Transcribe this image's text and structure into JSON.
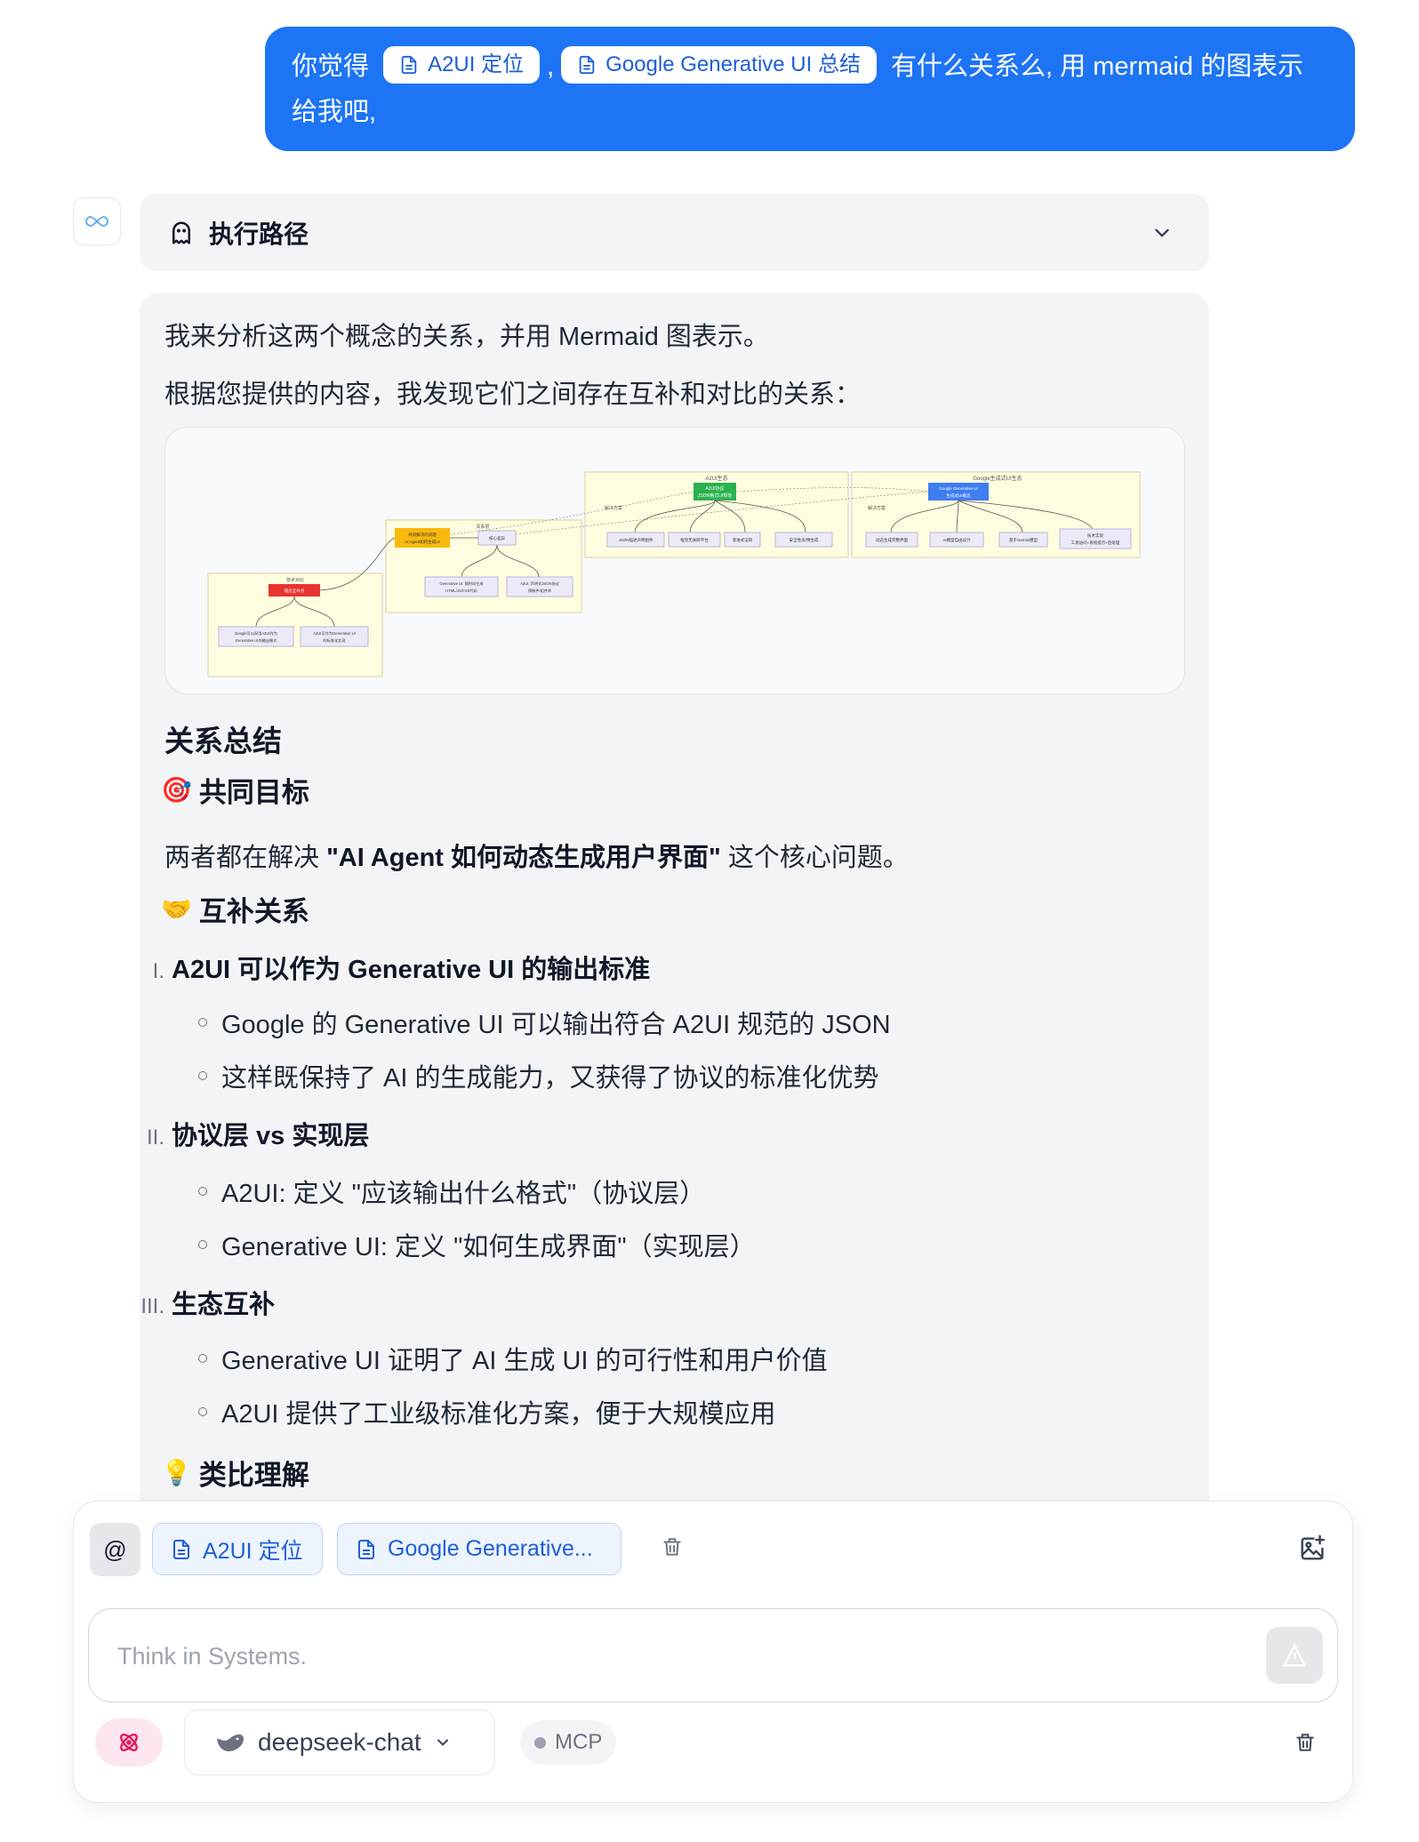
{
  "user_message": {
    "prefix": "你觉得",
    "ref1": "A2UI 定位",
    "comma": ",",
    "ref2": "Google Generative UI 总结",
    "suffix": "有什么关系么, 用 mermaid 的图表示给我吧,"
  },
  "execution_path": {
    "title": "执行路径"
  },
  "answer": {
    "intro": "我来分析这两个概念的关系，并用 Mermaid 图表示。",
    "intro2": "根据您提供的内容，我发现它们之间存在互补和对比的关系：",
    "diagram": {
      "group_a2ui": "A2UI生态",
      "group_google": "Google生成式UI生态",
      "group_relation": "关系层",
      "group_compare": "技术对比",
      "node_a2ui": "A2UI协议",
      "node_a2ui_sub": "JSON格式UI规范",
      "node_google": "Google Generative UI",
      "node_google_sub": "生成式UI概念",
      "label_solution": "解决方案",
      "node_problem": "共同解决的问题",
      "node_problem_sub": "AI Agent如何生成UI",
      "node_core": "核心差异",
      "node_compare_hi": "理念互补点",
      "a2ui_1": "JSON描述声明组件",
      "a2ui_2": "框架无关跨平台",
      "a2ui_3": "渐进式渲染",
      "a2ui_4": "安全性高/预生成",
      "g_1": "动态生成完整界面",
      "g_2": "AI模型自由设计",
      "g_3": "基于Gemini模型",
      "g_4": "技术实现",
      "g_4b": "工具访问+系统提示+后处理",
      "core_1": "Generative UI: 随时间生成",
      "core_1b": "HTML/JS/CSS代码",
      "core_2": "A2UI: 声明式JSON协议",
      "core_2b": "预制件/组件库",
      "cmp_1": "Google可以采用A2UI作为",
      "cmp_1b": "Generative UI的输出格式",
      "cmp_2": "A2UI可作为Generative UI",
      "cmp_2b": "的标准化实现"
    },
    "summary_title": "关系总结",
    "goal_emoji": "🎯",
    "goal_title": "共同目标",
    "goal_pre": "两者都在解决 ",
    "goal_bold": "\"AI Agent 如何动态生成用户界面\"",
    "goal_post": " 这个核心问题。",
    "comp_emoji": "🤝",
    "comp_title": "互补关系",
    "items": [
      {
        "num": "I.",
        "title": "A2UI 可以作为 Generative UI 的输出标准",
        "bullets": [
          "Google 的 Generative UI 可以输出符合 A2UI 规范的 JSON",
          "这样既保持了 AI 的生成能力，又获得了协议的标准化优势"
        ]
      },
      {
        "num": "II.",
        "title": "协议层 vs 实现层",
        "bullets": [
          "A2UI: 定义 \"应该输出什么格式\"（协议层）",
          "Generative UI: 定义 \"如何生成界面\"（实现层）"
        ]
      },
      {
        "num": "III.",
        "title": "生态互补",
        "bullets": [
          "Generative UI 证明了 AI 生成 UI 的可行性和用户价值",
          "A2UI 提供了工业级标准化方案，便于大规模应用"
        ]
      }
    ],
    "analogy_emoji": "💡",
    "analogy_title": "类比理解"
  },
  "composer": {
    "at_label": "@",
    "attachments": [
      "A2UI 定位",
      "Google Generative..."
    ],
    "input_value": "",
    "input_placeholder": "Think in Systems.",
    "model": "deepseek-chat",
    "mcp_label": "MCP"
  },
  "colors": {
    "user_bubble": "#1d74f5",
    "accent": "#1d5fd8",
    "panel_bg": "#f3f4f6"
  },
  "icons": [
    "file-icon",
    "ghost-icon",
    "chevron-down-icon",
    "trash-icon",
    "image-add-icon",
    "send-icon",
    "atom-icon",
    "whale-icon",
    "infinity-icon"
  ]
}
